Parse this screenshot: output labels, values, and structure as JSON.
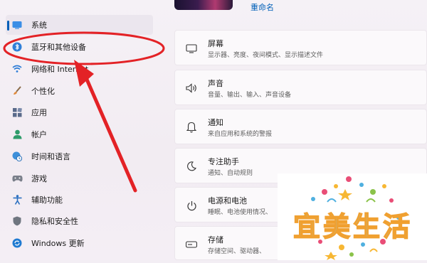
{
  "sidebar": {
    "items": [
      {
        "label": "系统",
        "icon": "monitor-icon",
        "active": true
      },
      {
        "label": "蓝牙和其他设备",
        "icon": "bluetooth-icon",
        "active": false
      },
      {
        "label": "网络和 Internet",
        "icon": "wifi-icon",
        "active": false
      },
      {
        "label": "个性化",
        "icon": "brush-icon",
        "active": false
      },
      {
        "label": "应用",
        "icon": "apps-icon",
        "active": false
      },
      {
        "label": "帐户",
        "icon": "person-icon",
        "active": false
      },
      {
        "label": "时间和语言",
        "icon": "globe-clock-icon",
        "active": false
      },
      {
        "label": "游戏",
        "icon": "gamepad-icon",
        "active": false
      },
      {
        "label": "辅助功能",
        "icon": "accessibility-icon",
        "active": false
      },
      {
        "label": "隐私和安全性",
        "icon": "shield-icon",
        "active": false
      },
      {
        "label": "Windows 更新",
        "icon": "update-icon",
        "active": false
      }
    ]
  },
  "header": {
    "rename_label": "重命名"
  },
  "settings": [
    {
      "title": "屏幕",
      "subtitle": "显示器、亮度、夜间模式、显示描述文件",
      "icon": "display-icon"
    },
    {
      "title": "声音",
      "subtitle": "音量、输出、输入、声音设备",
      "icon": "speaker-icon"
    },
    {
      "title": "通知",
      "subtitle": "来自应用和系统的警报",
      "icon": "bell-icon"
    },
    {
      "title": "专注助手",
      "subtitle": "通知、自动规则",
      "icon": "moon-icon"
    },
    {
      "title": "电源和电池",
      "subtitle": "睡眠、电池使用情况、",
      "icon": "power-icon"
    },
    {
      "title": "存储",
      "subtitle": "存储空间、驱动器、",
      "icon": "storage-icon"
    }
  ],
  "watermark": {
    "text": "宜美生活"
  },
  "colors": {
    "accent": "#005fb8",
    "annotation": "#e32226"
  }
}
